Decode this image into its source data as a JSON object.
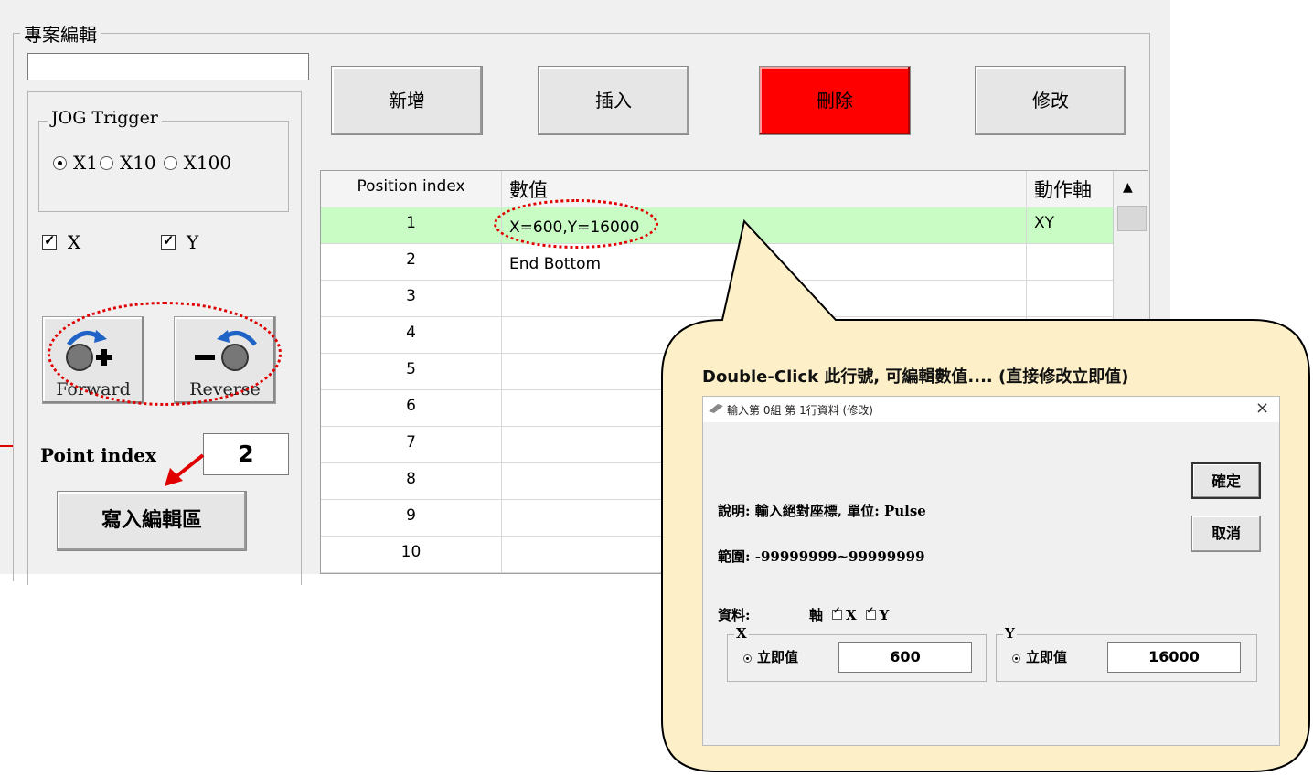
{
  "window": {
    "group_title": "專案編輯",
    "project_name_value": ""
  },
  "jog": {
    "title": "JOG Trigger",
    "options": [
      "X1",
      "X10",
      "X100"
    ],
    "selected": "X1"
  },
  "axes": {
    "x_label": "X",
    "y_label": "Y",
    "x_checked": true,
    "y_checked": true
  },
  "jog_buttons": {
    "forward_label": "Forward",
    "reverse_label": "Reverse"
  },
  "point": {
    "label": "Point index",
    "value": "2"
  },
  "write_button": "寫入編輯區",
  "toolbar": {
    "add": "新增",
    "insert": "插入",
    "delete": "刪除",
    "modify": "修改"
  },
  "colors": {
    "delete_bg": "#ff0000",
    "selected_row": "#c9fcc5",
    "bubble_fill": "#fdf0c8",
    "annotation_red": "#e00000"
  },
  "grid": {
    "headers": [
      "Position index",
      "數值",
      "動作軸"
    ],
    "rows": [
      {
        "index": "1",
        "value": "X=600,Y=16000",
        "axis": "XY"
      },
      {
        "index": "2",
        "value": "End Bottom",
        "axis": ""
      },
      {
        "index": "3",
        "value": "",
        "axis": ""
      },
      {
        "index": "4",
        "value": "",
        "axis": ""
      },
      {
        "index": "5",
        "value": "",
        "axis": ""
      },
      {
        "index": "6",
        "value": "",
        "axis": ""
      },
      {
        "index": "7",
        "value": "",
        "axis": ""
      },
      {
        "index": "8",
        "value": "",
        "axis": ""
      },
      {
        "index": "9",
        "value": "",
        "axis": ""
      },
      {
        "index": "10",
        "value": "",
        "axis": ""
      }
    ]
  },
  "callout": {
    "text": "Double-Click  此行號, 可編輯數值.... (直接修改立即值)"
  },
  "dialog": {
    "title": "輸入第 0組 第 1行資料 (修改)",
    "close": "×",
    "ok": "確定",
    "cancel": "取消",
    "description": "說明: 輸入絕對座標, 單位: Pulse",
    "range": "範圍: -99999999~99999999",
    "data_label": "資料:",
    "axis_label": "軸",
    "axis_x": "X",
    "axis_y": "Y",
    "x_group": "X",
    "y_group": "Y",
    "x_mode": "立即值",
    "y_mode": "立即值",
    "x_value": "600",
    "y_value": "16000"
  }
}
